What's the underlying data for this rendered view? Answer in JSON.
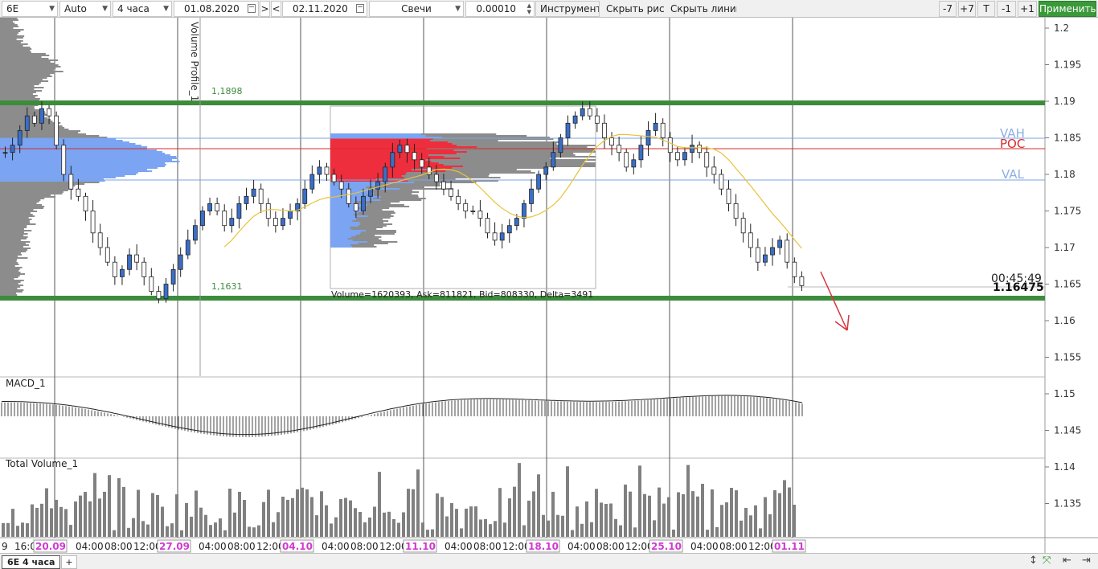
{
  "toolbar": {
    "symbol": "6E",
    "scale_mode": "Auto",
    "timeframe": "4 часа",
    "date_from": "01.08.2020",
    "nav_next": ">",
    "nav_prev": "<",
    "date_to": "02.11.2020",
    "chart_type": "Свечи",
    "tick_size": "0.00010",
    "tools_label": "Инструменты",
    "hide_drawings_label": "Скрыть рис.",
    "hide_lines_label": "Скрыть линии",
    "zoom_minus7": "-7",
    "zoom_plus7": "+7",
    "t_label": "T",
    "zoom_minus1": "-1",
    "zoom_plus1": "+1",
    "apply_label": "Применить"
  },
  "chart": {
    "profile_label": "Volume Profile_1",
    "level_high": "1,1898",
    "level_low": "1,1631",
    "vah_label": "VAH",
    "poc_label": "POC",
    "val_label": "VAL",
    "profile_stats": "Volume=1620393, Ask=811821, Bid=808330, Delta=3491",
    "countdown": "00:45:49",
    "last_price": "1.16475",
    "macd_label": "MACD_1",
    "volume_label": "Total Volume_1",
    "colors": {
      "support_line": "#3d8c3d",
      "poc_line": "#d92b2b",
      "va_line": "#7aa6e6",
      "profile_blue": "#7ba4f2",
      "profile_red": "#ee2d3d",
      "profile_gray": "#8c8c8c",
      "candle_up": "#3a6ec8",
      "ma_line": "#e8c23a",
      "arrow": "#d9343e",
      "date_highlight": "#d13ad1"
    }
  },
  "price_axis": [
    "1.2",
    "1.195",
    "1.19",
    "1.185",
    "1.18",
    "1.175",
    "1.17",
    "1.165",
    "1.16",
    "1.155",
    "1.15",
    "1.145",
    "1.14",
    "1.135"
  ],
  "time_axis": [
    {
      "text": "9",
      "hl": false
    },
    {
      "text": "16:00",
      "hl": false
    },
    {
      "text": "20.09",
      "hl": true
    },
    {
      "text": "04:00",
      "hl": false
    },
    {
      "text": "08:00",
      "hl": false
    },
    {
      "text": "12:00",
      "hl": false
    },
    {
      "text": "27.09",
      "hl": true
    },
    {
      "text": "04:00",
      "hl": false
    },
    {
      "text": "08:00",
      "hl": false
    },
    {
      "text": "12:00",
      "hl": false
    },
    {
      "text": "04.10",
      "hl": true
    },
    {
      "text": "04:00",
      "hl": false
    },
    {
      "text": "08:00",
      "hl": false
    },
    {
      "text": "12:00",
      "hl": false
    },
    {
      "text": "11.10",
      "hl": true
    },
    {
      "text": "04:00",
      "hl": false
    },
    {
      "text": "08:00",
      "hl": false
    },
    {
      "text": "12:00",
      "hl": false
    },
    {
      "text": "18.10",
      "hl": true
    },
    {
      "text": "04:00",
      "hl": false
    },
    {
      "text": "08:00",
      "hl": false
    },
    {
      "text": "12:00",
      "hl": false
    },
    {
      "text": "25.10",
      "hl": true
    },
    {
      "text": "04:00",
      "hl": false
    },
    {
      "text": "08:00",
      "hl": false
    },
    {
      "text": "12:00",
      "hl": false
    },
    {
      "text": "01.11",
      "hl": true
    }
  ],
  "tabs": {
    "main": "6E 4 часа",
    "add": "+"
  }
}
